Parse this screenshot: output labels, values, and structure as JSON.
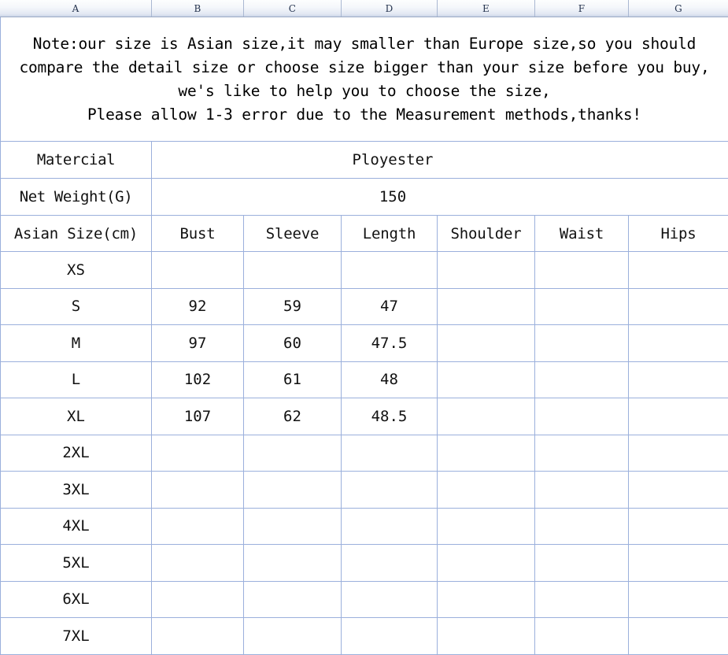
{
  "spreadsheet": {
    "column_headers": [
      "A",
      "B",
      "C",
      "D",
      "E",
      "F",
      "G"
    ]
  },
  "note": {
    "lines": [
      "Note:our size is Asian size,it may smaller than Europe size,so you should",
      "compare the detail size or choose size bigger than your size before you buy,",
      "we's like to help you to choose the size,",
      "Please allow 1-3 error due to the Measurement methods,thanks!"
    ]
  },
  "info": {
    "material_label": "Matercial",
    "material_value": "Ployester",
    "weight_label": "Net Weight(G)",
    "weight_value": "150"
  },
  "table": {
    "headers": [
      "Asian Size(cm)",
      "Bust",
      "Sleeve",
      "Length",
      "Shoulder",
      "Waist",
      "Hips"
    ],
    "rows": [
      {
        "size": "XS",
        "bust": "",
        "sleeve": "",
        "length": "",
        "shoulder": "",
        "waist": "",
        "hips": ""
      },
      {
        "size": "S",
        "bust": "92",
        "sleeve": "59",
        "length": "47",
        "shoulder": "",
        "waist": "",
        "hips": ""
      },
      {
        "size": "M",
        "bust": "97",
        "sleeve": "60",
        "length": "47.5",
        "shoulder": "",
        "waist": "",
        "hips": ""
      },
      {
        "size": "L",
        "bust": "102",
        "sleeve": "61",
        "length": "48",
        "shoulder": "",
        "waist": "",
        "hips": ""
      },
      {
        "size": "XL",
        "bust": "107",
        "sleeve": "62",
        "length": "48.5",
        "shoulder": "",
        "waist": "",
        "hips": ""
      },
      {
        "size": "2XL",
        "bust": "",
        "sleeve": "",
        "length": "",
        "shoulder": "",
        "waist": "",
        "hips": ""
      },
      {
        "size": "3XL",
        "bust": "",
        "sleeve": "",
        "length": "",
        "shoulder": "",
        "waist": "",
        "hips": ""
      },
      {
        "size": "4XL",
        "bust": "",
        "sleeve": "",
        "length": "",
        "shoulder": "",
        "waist": "",
        "hips": ""
      },
      {
        "size": "5XL",
        "bust": "",
        "sleeve": "",
        "length": "",
        "shoulder": "",
        "waist": "",
        "hips": ""
      },
      {
        "size": "6XL",
        "bust": "",
        "sleeve": "",
        "length": "",
        "shoulder": "",
        "waist": "",
        "hips": ""
      },
      {
        "size": "7XL",
        "bust": "",
        "sleeve": "",
        "length": "",
        "shoulder": "",
        "waist": "",
        "hips": ""
      }
    ]
  },
  "colors": {
    "grid_line": "#9bb0dc",
    "header_bar_text": "#24324d",
    "cell_text": "#111111"
  }
}
